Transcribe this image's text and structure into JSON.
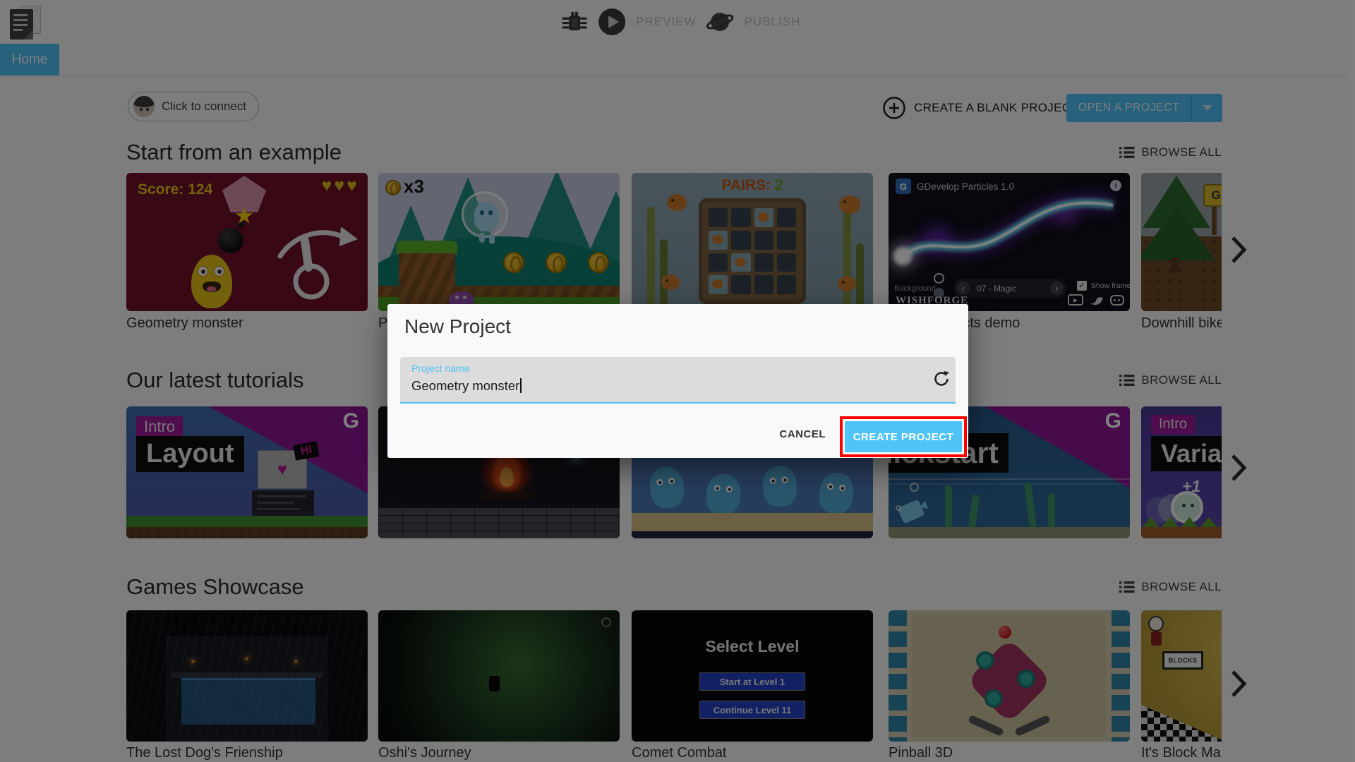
{
  "toolbar": {
    "preview": "PREVIEW",
    "publish": "PUBLISH"
  },
  "tabs": {
    "home": "Home"
  },
  "actions": {
    "connect": "Click to connect",
    "create_blank": "CREATE A BLANK PROJECT",
    "open_project": "OPEN A PROJECT"
  },
  "sections": [
    {
      "title": "Start from an example",
      "browse": "BROWSE ALL"
    },
    {
      "title": "Our latest tutorials",
      "browse": "BROWSE ALL"
    },
    {
      "title": "Games Showcase",
      "browse": "BROWSE ALL"
    }
  ],
  "examples": {
    "titles": [
      "Geometry monster",
      "Platformer",
      "",
      "Particle effects demo",
      "Downhill bike physics demo"
    ],
    "geometry": {
      "score": "Score: 124",
      "hearts": "♥♥♥"
    },
    "platformer": {
      "coins": "x3"
    },
    "pairs": {
      "label": "PAIRS:",
      "value": "2"
    },
    "particles": {
      "title": "GDevelop Particles 1.0",
      "info": "i",
      "background": "Background",
      "preset": "07 - Magic",
      "show_frame": "Show frame",
      "brand": "WISHFORGE",
      "logo": "G"
    },
    "downhill": {
      "sign": "G"
    }
  },
  "tutorials": {
    "layout": {
      "tag": "Intro",
      "word": "Layout",
      "hi": "Hi",
      "logo": "G",
      "heart": "♥"
    },
    "quickstart": {
      "word": "Quickstart",
      "logo": "G"
    },
    "variables": {
      "tag": "Intro",
      "word": "Variables",
      "plus": "+1"
    }
  },
  "showcase": {
    "titles": [
      "The Lost Dog's Frienship",
      "Oshi's Journey",
      "Comet Combat",
      "Pinball 3D",
      "It's Block Man"
    ],
    "comet": {
      "title": "Select Level",
      "button1": "Start at Level 1",
      "button2": "Continue Level 11"
    },
    "blocks": {
      "sign": "BLOCKS"
    }
  },
  "modal": {
    "title": "New Project",
    "field_label": "Project name",
    "field_value": "Geometry monster",
    "cancel": "CANCEL",
    "create": "CREATE PROJECT"
  },
  "icons": {
    "check": "✓",
    "chev_left": "‹",
    "chev_right": "›",
    "play": "▶"
  },
  "colors": {
    "accent": "#4fc3f7",
    "annotation_red": "#ff0000",
    "tab_blue": "#4fc3f7"
  }
}
